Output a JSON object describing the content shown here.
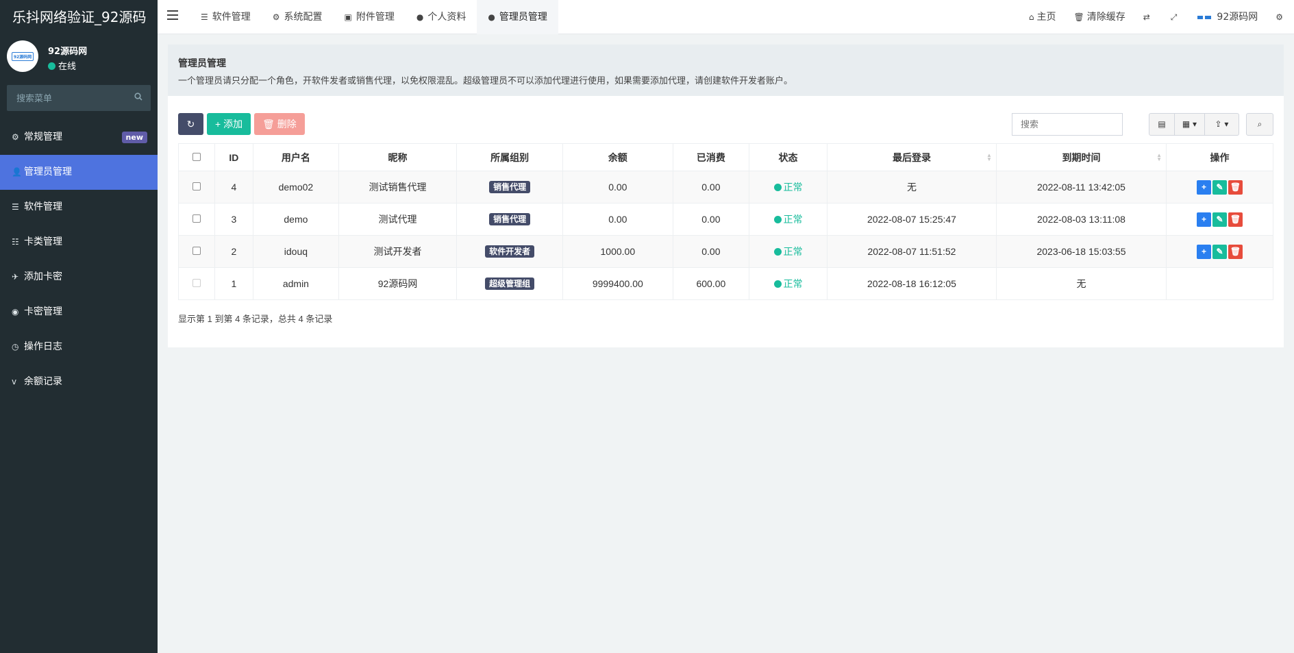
{
  "app": {
    "title": "乐抖网络验证_92源码",
    "user_name": "92源码网",
    "user_status": "在线",
    "avatar_text": "92源码网"
  },
  "sidebar": {
    "search_placeholder": "搜索菜单",
    "items": [
      {
        "icon": "gears-icon",
        "glyph": "⚙",
        "label": "常规管理",
        "badge": "new"
      },
      {
        "icon": "user-icon",
        "glyph": "👤",
        "label": "管理员管理",
        "active": true
      },
      {
        "icon": "list-icon",
        "glyph": "☰",
        "label": "软件管理"
      },
      {
        "icon": "tasks-icon",
        "glyph": "☷",
        "label": "卡类管理"
      },
      {
        "icon": "paper-plane-icon",
        "glyph": "✈",
        "label": "添加卡密"
      },
      {
        "icon": "rss-icon",
        "glyph": "◉",
        "label": "卡密管理"
      },
      {
        "icon": "clock-icon",
        "glyph": "◷",
        "label": "操作日志"
      },
      {
        "icon": "vimeo-icon",
        "glyph": "v",
        "label": "余额记录"
      }
    ]
  },
  "topbar": {
    "tabs": [
      {
        "icon": "list-icon",
        "glyph": "☰",
        "label": "软件管理"
      },
      {
        "icon": "gear-icon",
        "glyph": "⚙",
        "label": "系统配置"
      },
      {
        "icon": "image-icon",
        "glyph": "▣",
        "label": "附件管理"
      },
      {
        "icon": "user-icon",
        "glyph": "●",
        "label": "个人资料"
      },
      {
        "icon": "user-icon",
        "glyph": "●",
        "label": "管理员管理",
        "active": true
      }
    ],
    "home_label": "主页",
    "clear_cache_label": "清除缓存",
    "site_label": "92源码网"
  },
  "callout": {
    "title": "管理员管理",
    "description": "一个管理员请只分配一个角色，开软件发者或销售代理，以免权限混乱。超级管理员不可以添加代理进行使用，如果需要添加代理，请创建软件开发者账户。"
  },
  "toolbar": {
    "add_label": "添加",
    "delete_label": "删除",
    "search_placeholder": "搜索"
  },
  "table": {
    "columns": [
      "ID",
      "用户名",
      "昵称",
      "所属组别",
      "余额",
      "已消费",
      "状态",
      "最后登录",
      "到期时间",
      "操作"
    ],
    "rows": [
      {
        "id": "4",
        "username": "demo02",
        "nickname": "测试销售代理",
        "group": "销售代理",
        "balance": "0.00",
        "spent": "0.00",
        "status": "正常",
        "last_login": "无",
        "expire": "2022-08-11 13:42:05"
      },
      {
        "id": "3",
        "username": "demo",
        "nickname": "测试代理",
        "group": "销售代理",
        "balance": "0.00",
        "spent": "0.00",
        "status": "正常",
        "last_login": "2022-08-07 15:25:47",
        "expire": "2022-08-03 13:11:08"
      },
      {
        "id": "2",
        "username": "idouq",
        "nickname": "测试开发者",
        "group": "软件开发者",
        "balance": "1000.00",
        "spent": "0.00",
        "status": "正常",
        "last_login": "2022-08-07 11:51:52",
        "expire": "2023-06-18 15:03:55"
      },
      {
        "id": "1",
        "username": "admin",
        "nickname": "92源码网",
        "group": "超级管理组",
        "balance": "9999400.00",
        "spent": "600.00",
        "status": "正常",
        "last_login": "2022-08-18 16:12:05",
        "expire": "无"
      }
    ],
    "footer": "显示第 1 到第 4 条记录，总共 4 条记录"
  },
  "colors": {
    "sidebar_bg": "#222d32",
    "active_menu": "#4e73df",
    "success": "#18bc9c",
    "danger": "#e74c3c",
    "primary": "#2a7ff0"
  }
}
